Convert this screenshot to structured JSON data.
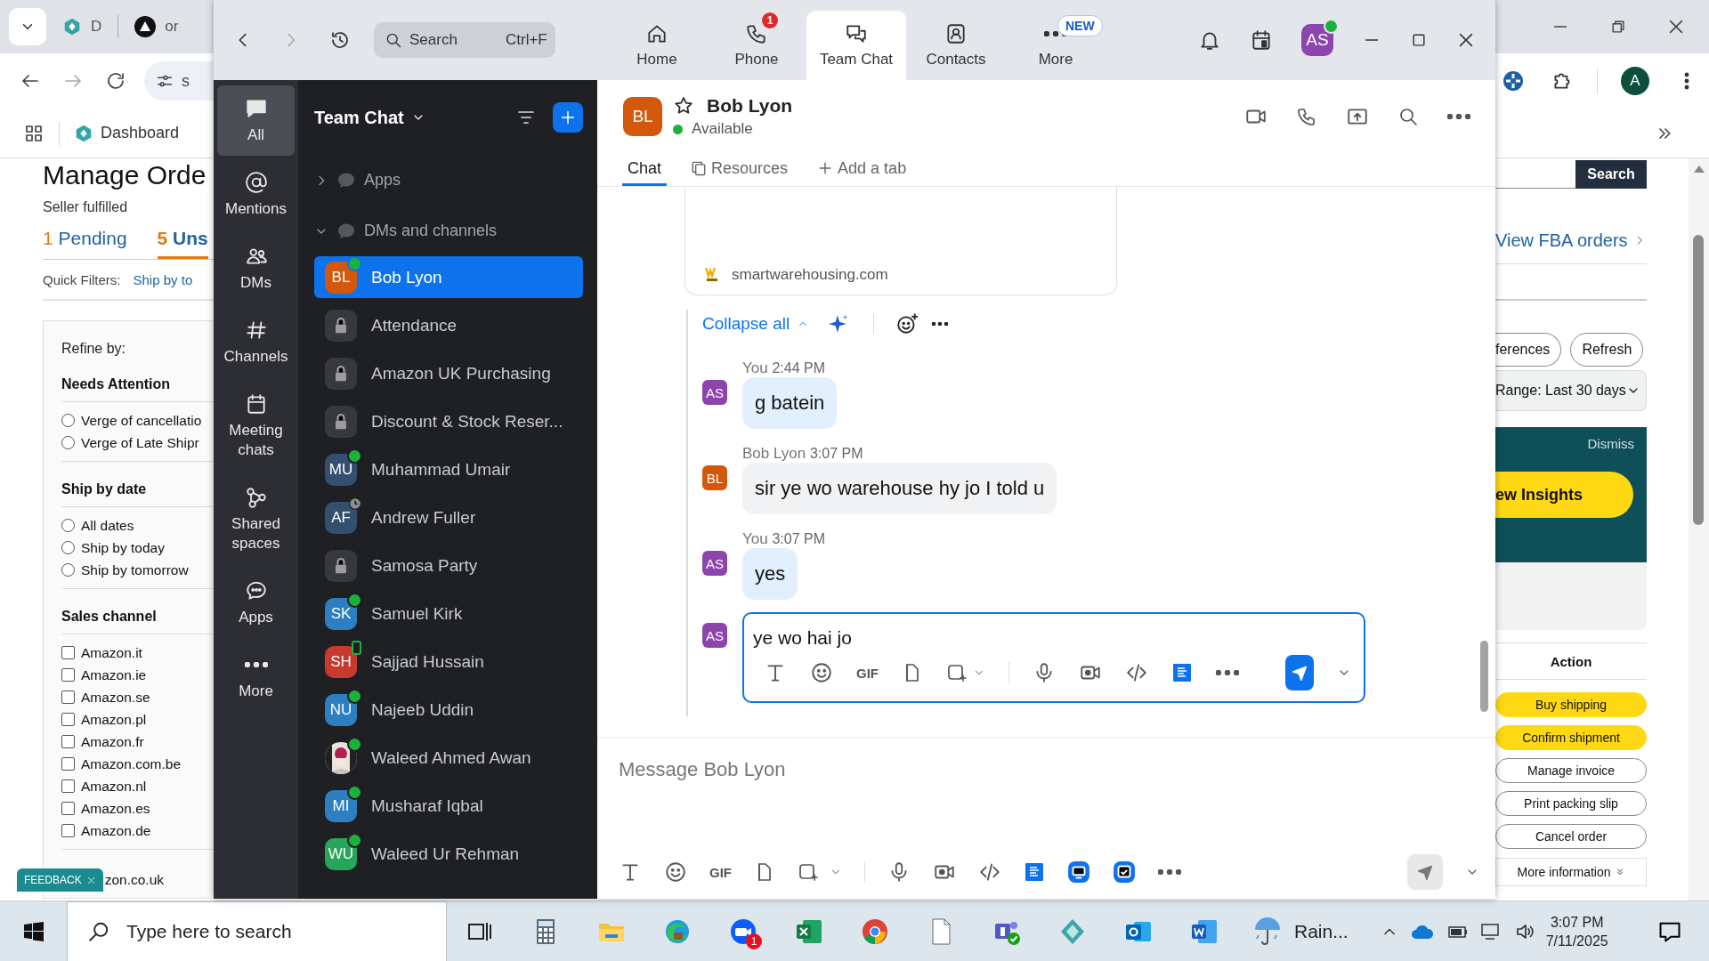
{
  "browser": {
    "tabs": [
      {
        "label": "D"
      },
      {
        "label": "or"
      }
    ],
    "address_text": "s",
    "bookmark": "Dashboard",
    "profile_initial": "A",
    "page": {
      "title": "Manage Orde",
      "subtitle": "Seller fulfilled",
      "order_tabs": [
        {
          "count": "1",
          "label": "Pending",
          "selected": false
        },
        {
          "count": "5",
          "label": "Uns",
          "selected": true
        }
      ],
      "quick_filters_label": "Quick Filters:",
      "quick_filter": "Ship by to",
      "refine_label": "Refine by:",
      "filter_groups": [
        {
          "title": "Needs Attention",
          "options": [
            {
              "kind": "radio",
              "label": "Verge of cancellatio",
              "checked": false
            },
            {
              "kind": "radio",
              "label": "Verge of Late Shipr",
              "checked": false
            }
          ]
        },
        {
          "title": "Ship by date",
          "options": [
            {
              "kind": "radio",
              "label": "All dates",
              "checked": false
            },
            {
              "kind": "radio",
              "label": "Ship by today",
              "checked": false
            },
            {
              "kind": "radio",
              "label": "Ship by tomorrow",
              "checked": false
            }
          ]
        },
        {
          "title": "Sales channel",
          "options": [
            {
              "kind": "checkbox",
              "label": "Amazon.it",
              "checked": false
            },
            {
              "kind": "checkbox",
              "label": "Amazon.ie",
              "checked": false
            },
            {
              "kind": "checkbox",
              "label": "Amazon.se",
              "checked": false
            },
            {
              "kind": "checkbox",
              "label": "Amazon.pl",
              "checked": false
            },
            {
              "kind": "checkbox",
              "label": "Amazon.fr",
              "checked": false
            },
            {
              "kind": "checkbox",
              "label": "Amazon.com.be",
              "checked": false
            },
            {
              "kind": "checkbox",
              "label": "Amazon.nl",
              "checked": false
            },
            {
              "kind": "checkbox",
              "label": "Amazon.es",
              "checked": false
            },
            {
              "kind": "checkbox",
              "label": "Amazon.de",
              "checked": false
            }
          ]
        }
      ],
      "partial_option": "zon.co.uk",
      "feedback_badge": "FEEDBACK",
      "search_button": "Search",
      "fba_link": "View FBA orders",
      "buttons": [
        "ferences",
        "Refresh"
      ],
      "date_range": "Range: Last 30 days",
      "banner": {
        "dismiss": "Dismiss",
        "cta": "ew Insights"
      },
      "action_header": "Action",
      "actions": [
        {
          "label": "Buy shipping",
          "kind": "primary"
        },
        {
          "label": "Confirm shipment",
          "kind": "primary"
        },
        {
          "label": "Manage invoice",
          "kind": "secondary"
        },
        {
          "label": "Print packing slip",
          "kind": "secondary"
        },
        {
          "label": "Cancel order",
          "kind": "secondary"
        }
      ],
      "more_info": "More information"
    }
  },
  "zoom": {
    "search": {
      "placeholder": "Search",
      "shortcut": "Ctrl+F"
    },
    "nav_tabs": [
      {
        "label": "Home",
        "selected": false
      },
      {
        "label": "Phone",
        "selected": false,
        "badge": {
          "kind": "count",
          "text": "1"
        }
      },
      {
        "label": "Team Chat",
        "selected": true
      },
      {
        "label": "Contacts",
        "selected": false
      },
      {
        "label": "More",
        "selected": false,
        "badge": {
          "kind": "pill",
          "text": "NEW"
        }
      }
    ],
    "user": {
      "initials": "AS",
      "color": "#8e44ad",
      "online": true
    },
    "rail": [
      {
        "label": "All",
        "selected": true
      },
      {
        "label": "Mentions",
        "selected": false
      },
      {
        "label": "DMs",
        "selected": false
      },
      {
        "label": "Channels",
        "selected": false
      },
      {
        "label": "Meeting chats",
        "selected": false
      },
      {
        "label": "Shared spaces",
        "selected": false
      },
      {
        "label": "Apps",
        "selected": false
      },
      {
        "label": "More",
        "selected": false
      }
    ],
    "list": {
      "title": "Team Chat",
      "sections": [
        {
          "label": "Apps",
          "expanded": false
        },
        {
          "label": "DMs and channels",
          "expanded": true
        }
      ],
      "items": [
        {
          "kind": "person",
          "name": "Bob Lyon",
          "initials": "BL",
          "color": "#d4580c",
          "online": true,
          "selected": true
        },
        {
          "kind": "channel",
          "name": "Attendance",
          "selected": false
        },
        {
          "kind": "channel",
          "name": "Amazon UK Purchasing",
          "selected": false
        },
        {
          "kind": "channel",
          "name": "Discount & Stock Reser...",
          "selected": false
        },
        {
          "kind": "person",
          "name": "Muhammad Umair",
          "initials": "MU",
          "color": "#34506e",
          "online": true,
          "selected": false
        },
        {
          "kind": "person",
          "name": "Andrew Fuller",
          "initials": "AF",
          "color": "#34506e",
          "away": true,
          "selected": false
        },
        {
          "kind": "channel",
          "name": "Samosa Party",
          "selected": false
        },
        {
          "kind": "person",
          "name": "Samuel Kirk",
          "initials": "SK",
          "color": "#2d7fc1",
          "online": true,
          "selected": false
        },
        {
          "kind": "person",
          "name": "Sajjad Hussain",
          "initials": "SH",
          "color": "#c8392e",
          "mobile": true,
          "selected": false
        },
        {
          "kind": "person",
          "name": "Najeeb Uddin",
          "initials": "NU",
          "color": "#2d7fc1",
          "online": true,
          "selected": false
        },
        {
          "kind": "person",
          "name": "Waleed Ahmed Awan",
          "online": true,
          "selected": false
        },
        {
          "kind": "person",
          "name": "Musharaf Iqbal",
          "initials": "MI",
          "color": "#2d7fc1",
          "online": true,
          "selected": false
        },
        {
          "kind": "person",
          "name": "Waleed Ur Rehman",
          "initials": "WU",
          "color": "#27a55a",
          "online": true,
          "selected": false
        }
      ]
    },
    "chat": {
      "initials": "BL",
      "color": "#d4580c",
      "starred": false,
      "name": "Bob Lyon",
      "status": "Available",
      "online": true,
      "tabs": [
        {
          "label": "Chat",
          "selected": true
        },
        {
          "label": "Resources",
          "selected": false
        },
        {
          "label": "Add a tab",
          "selected": false
        }
      ],
      "link_domain": "smartwarehousing.com",
      "collapse_label": "Collapse all",
      "messages": [
        {
          "sender": "You",
          "time": "2:44 PM",
          "initials": "AS",
          "color": "#8e44ad",
          "text": "g batein",
          "own": true
        },
        {
          "sender": "Bob Lyon",
          "time": "3:07 PM",
          "initials": "BL",
          "color": "#d4580c",
          "text": "sir ye wo warehouse hy jo I told u",
          "own": false
        },
        {
          "sender": "You",
          "time": "3:07 PM",
          "initials": "AS",
          "color": "#8e44ad",
          "text": "yes",
          "own": true
        }
      ],
      "reply": {
        "initials": "AS",
        "color": "#8e44ad",
        "value": "ye wo hai jo",
        "gif": "GIF"
      },
      "composer": {
        "placeholder": "Message Bob Lyon",
        "gif": "GIF"
      }
    }
  },
  "taskbar": {
    "search_placeholder": "Type here to search",
    "app_badge": "1",
    "weather": "Rain...",
    "time": "3:07 PM",
    "date": "7/11/2025"
  }
}
